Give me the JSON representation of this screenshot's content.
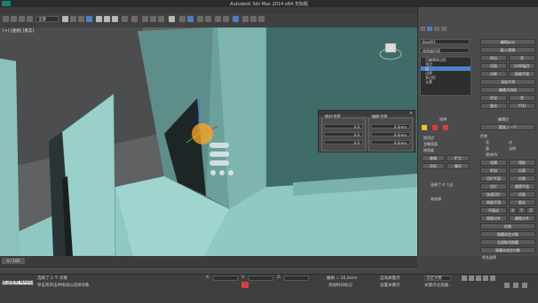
{
  "window": {
    "title": "Autodesk 3ds Max 2014 x64   无标题"
  },
  "toolbar": {
    "view_dropdown": "全部"
  },
  "viewport": {
    "label": "[+] [透视] [真实]"
  },
  "dialog": {
    "col_left_title": "绝对:世界",
    "col_right_title": "偏移:世界",
    "left_fields": [
      {
        "axis": "X",
        "value": "0.0"
      },
      {
        "axis": "Y",
        "value": "0.0"
      },
      {
        "axis": "Z",
        "value": "0.0"
      }
    ],
    "right_fields": [
      {
        "axis": "X",
        "value": "0.0mm"
      },
      {
        "axis": "Y",
        "value": "0.0mm"
      },
      {
        "axis": "Z",
        "value": "0.0mm"
      }
    ]
  },
  "cmdpanel": {
    "object_name": "Box001",
    "modifier_list": "修改器列表",
    "stack": [
      "可编辑多边形",
      "顶点",
      "边",
      "边界",
      "多边形",
      "元素"
    ],
    "stack_selected_index": 2,
    "right_buttons": [
      "编辑poly",
      "插入/倒角",
      "挤出",
      "壳",
      "切角",
      "UVW展开",
      "对称",
      "网格平滑",
      "涡轮平滑",
      "编辑几何体",
      "优化",
      "壳",
      "细化",
      "FFD"
    ],
    "section_select": "选择",
    "select_opts": [
      "按顶点",
      "忽略背面",
      "按角度",
      "收缩",
      "扩大",
      "环形",
      "循环"
    ],
    "selected_info": "选择了 4 个边",
    "soft_select": "软选择",
    "edit_edges": "编辑边",
    "edit_geom": "编辑几何体",
    "bottom_label": "重复上一个",
    "bottom_btns": [
      "约束",
      "无",
      "边",
      "面",
      "法线",
      "保持UV",
      "创建",
      "塌陷",
      "附加",
      "分离",
      "切片平面",
      "分割",
      "切片",
      "重置平面",
      "快速切片",
      "切割",
      "网格平滑",
      "细化",
      "平面化",
      "X",
      "Y",
      "Z",
      "视图对齐",
      "栅格对齐",
      "松弛",
      "隐藏选定对象",
      "全部取消隐藏",
      "隐藏未选定对象",
      "命名选择",
      "复制",
      "粘贴",
      "删除孤立顶点",
      "完全交互"
    ]
  },
  "timeline": {
    "frame": "0 / 100"
  },
  "statusbar": {
    "welcome": "欢迎使用 MAXScr",
    "status_line": "选择了 1 个 对象",
    "hint": "单击或单击并拖动以选择对象",
    "grid": "栅格 = 10.0mm",
    "add_time": "添加时间标记",
    "autokey": "自动关键点",
    "set_key": "设置关键点",
    "selected": "选定对象",
    "key_filter": "关键点过滤器...",
    "x_label": "X:",
    "y_label": "Y:",
    "z_label": "Z:"
  }
}
